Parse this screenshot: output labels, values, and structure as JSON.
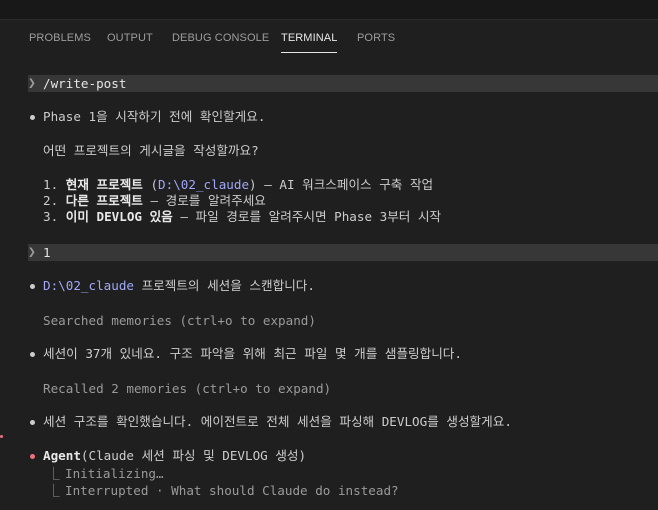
{
  "panel": {
    "tabs": [
      {
        "label": "PROBLEMS"
      },
      {
        "label": "OUTPUT"
      },
      {
        "label": "DEBUG CONSOLE"
      },
      {
        "label": "TERMINAL"
      },
      {
        "label": "PORTS"
      }
    ],
    "active_tab": "TERMINAL"
  },
  "terminal": {
    "prompt1": {
      "chevron": "❯",
      "text": "/write-post"
    },
    "msg1": "Phase 1을 시작하기 전에 확인할게요.",
    "question": "어떤 프로젝트의 게시글을 작성할까요?",
    "options": [
      {
        "num": "1.",
        "title": "현재 프로젝트",
        "open": " (",
        "path": "D:\\02_claude",
        "rest": ") — AI 워크스페이스 구축 작업"
      },
      {
        "num": "2.",
        "title": "다른 프로젝트",
        "rest": " — 경로를 알려주세요"
      },
      {
        "num": "3.",
        "title": "이미 DEVLOG 있음",
        "rest": " — 파일 경로를 알려주시면 Phase 3부터 시작"
      }
    ],
    "prompt2": {
      "chevron": "❯",
      "text": "1"
    },
    "msg2": {
      "path": "D:\\02_claude",
      "rest": " 프로젝트의 세션을 스캔합니다."
    },
    "searched": "Searched memories (ctrl+o to expand)",
    "msg3": "세션이 37개 있네요. 구조 파악을 위해 최근 파일 몇 개를 샘플링합니다.",
    "recalled": "Recalled 2 memories (ctrl+o to expand)",
    "msg4": "세션 구조를 확인했습니다. 에이전트로 전체 세션을 파싱해 DEVLOG를 생성할게요.",
    "agent": {
      "name": "Agent",
      "args": "(Claude 세션 파싱 및 DEVLOG 생성)"
    },
    "elbow": "⎿",
    "sub1": "Initializing…",
    "sub2": "Interrupted · What should Claude do instead?"
  },
  "colors": {
    "background": "#1f1f1f",
    "text": "#cccccc",
    "path": "#a0a7f5",
    "agent_bullet": "#f1707b",
    "prompt_bar": "#373737"
  }
}
